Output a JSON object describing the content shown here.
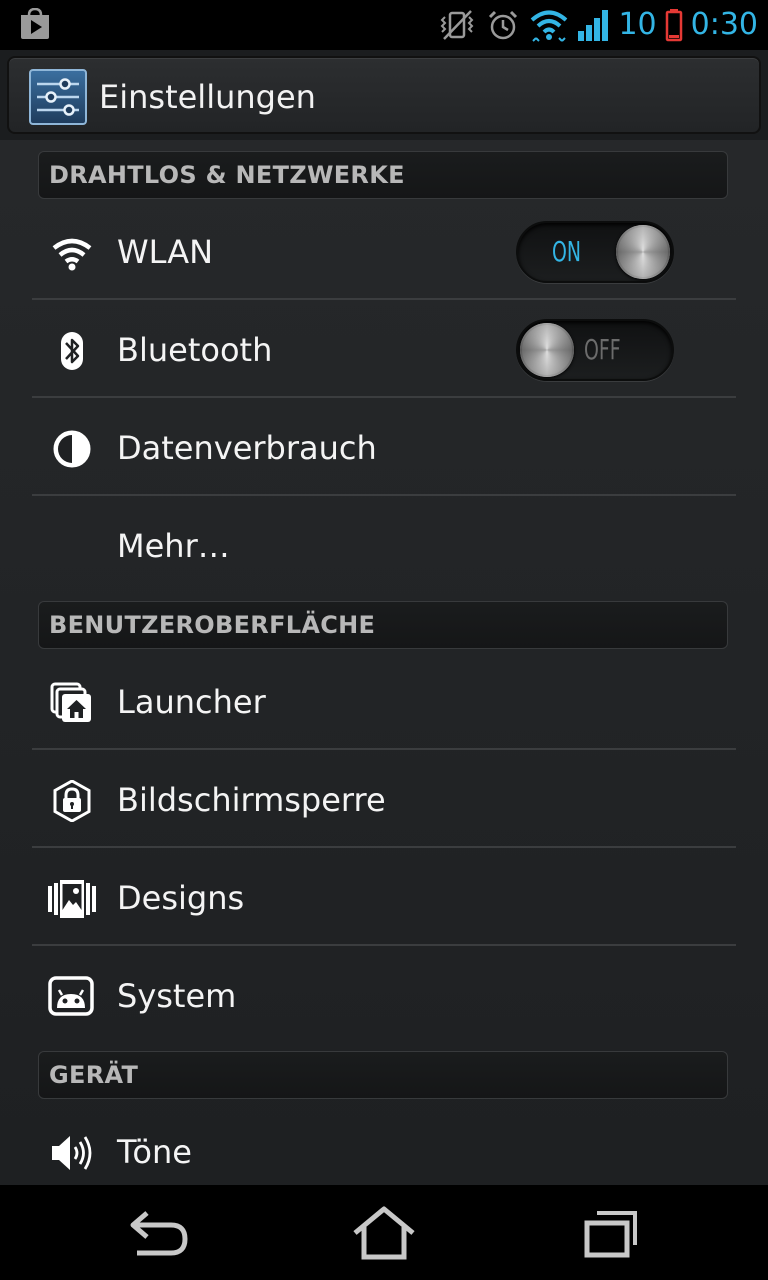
{
  "status_bar": {
    "icons": [
      "play-store-icon",
      "vibrate-off-icon",
      "alarm-icon",
      "wifi-icon",
      "signal-icon",
      "battery-icon"
    ],
    "battery_level": "10",
    "time": "0:30",
    "accent_color": "#33b5e5",
    "battery_color": "#e53935"
  },
  "action_bar": {
    "icon": "settings-sliders-icon",
    "title": "Einstellungen"
  },
  "sections": [
    {
      "header": "DRAHTLOS & NETZWERKE",
      "items": [
        {
          "label": "WLAN",
          "icon": "wifi-icon",
          "toggle": "ON",
          "toggle_on": true
        },
        {
          "label": "Bluetooth",
          "icon": "bluetooth-icon",
          "toggle": "OFF",
          "toggle_on": false
        },
        {
          "label": "Datenverbrauch",
          "icon": "data-usage-icon"
        },
        {
          "label": "Mehr…"
        }
      ]
    },
    {
      "header": "BENUTZEROBERFLÄCHE",
      "items": [
        {
          "label": "Launcher",
          "icon": "launcher-home-icon"
        },
        {
          "label": "Bildschirmsperre",
          "icon": "lock-screen-icon"
        },
        {
          "label": "Designs",
          "icon": "themes-picture-icon"
        },
        {
          "label": "System",
          "icon": "system-android-icon"
        }
      ]
    },
    {
      "header": "GERÄT",
      "items": [
        {
          "label": "Töne",
          "icon": "speaker-icon"
        }
      ]
    }
  ],
  "nav_bar": {
    "buttons": [
      "back-icon",
      "home-icon",
      "recent-apps-icon"
    ]
  }
}
